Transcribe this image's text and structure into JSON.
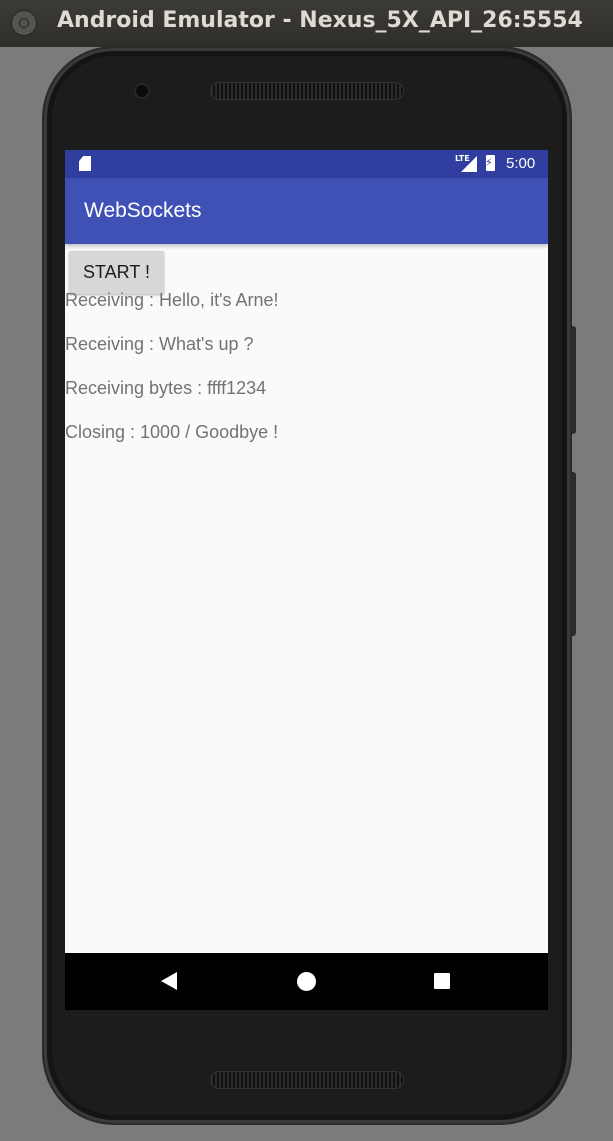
{
  "window": {
    "title": "Android Emulator - Nexus_5X_API_26:5554"
  },
  "status_bar": {
    "network_label": "LTE",
    "time": "5:00",
    "icons": [
      "sd-card-icon",
      "signal-icon",
      "battery-charging-icon"
    ],
    "color": "#303f9f"
  },
  "app_bar": {
    "title": "WebSockets",
    "color": "#3f51b5"
  },
  "main": {
    "start_button_label": "START !",
    "messages": [
      "Receiving : Hello, it's Arne!",
      "Receiving : What's up ?",
      "Receiving bytes : ffff1234",
      "Closing : 1000 / Goodbye !"
    ]
  },
  "nav_bar": {
    "icons": [
      "back-icon",
      "home-icon",
      "recents-icon"
    ]
  }
}
